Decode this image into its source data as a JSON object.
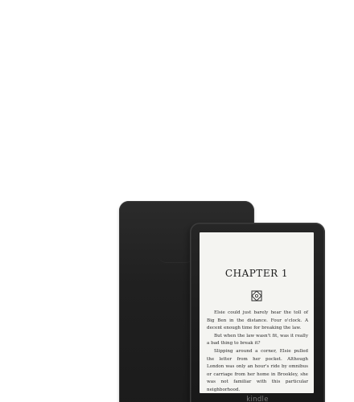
{
  "product": {
    "brand_label": "kindle"
  },
  "screen": {
    "chapter_title": "CHAPTER 1",
    "paragraphs": [
      "Elsie could just barely hear the toll of Big Ben in the distance. Four o'clock. A decent enough time for breaking the law.",
      "But when the law wasn't fit, was it really a bad thing to break it?",
      "Slipping around a corner, Elsie pulled the letter from her pocket. Although London was only an hour's ride by omnibus or carriage from her home in Brookley, she was not familiar with this particular neighborhood."
    ]
  },
  "colors": {
    "background": "#ffffff",
    "device_body": "#1e1e1e",
    "screen": "#f4f4f1",
    "ink": "#2a2a2a"
  }
}
